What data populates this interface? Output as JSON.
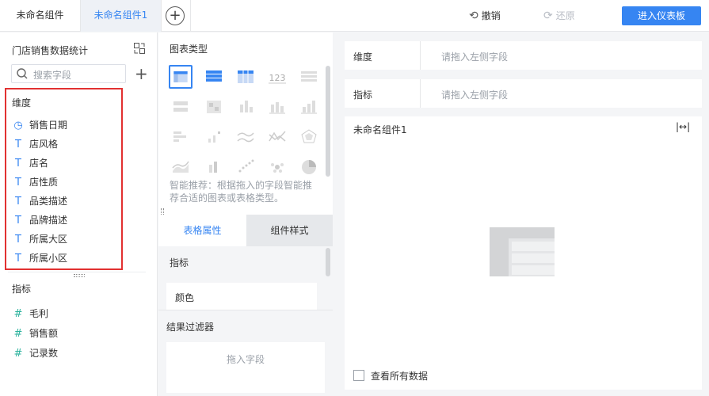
{
  "tabs": {
    "tab1": "未命名组件",
    "tab2": "未命名组件1"
  },
  "toolbar": {
    "undo": "撤销",
    "redo": "还原",
    "enter_dashboard": "进入仪表板"
  },
  "left": {
    "dataset_title": "门店销售数据统计",
    "search_placeholder": "搜索字段",
    "dimensions_header": "维度",
    "dimensions": [
      "销售日期",
      "店风格",
      "店名",
      "店性质",
      "品类描述",
      "品牌描述",
      "所属大区",
      "所属小区"
    ],
    "measures_header": "指标",
    "measures": [
      "毛利",
      "销售额",
      "记录数"
    ]
  },
  "middle": {
    "chart_type_title": "图表类型",
    "hint": "智能推荐：根据拖入的字段智能推荐合适的图表或表格类型。",
    "tab_table_props": "表格属性",
    "tab_component_style": "组件样式",
    "metric_label": "指标",
    "color_label": "颜色",
    "result_filter": "结果过滤器",
    "drop_field": "拖入字段"
  },
  "right": {
    "dimension_label": "维度",
    "dimension_placeholder": "请拖入左侧字段",
    "metric_label": "指标",
    "metric_placeholder": "请拖入左侧字段",
    "component_title": "未命名组件1",
    "view_all_data": "查看所有数据"
  },
  "colors": {
    "accent": "#3685f2",
    "highlight": "#e23131",
    "measure": "#2bb29d"
  }
}
